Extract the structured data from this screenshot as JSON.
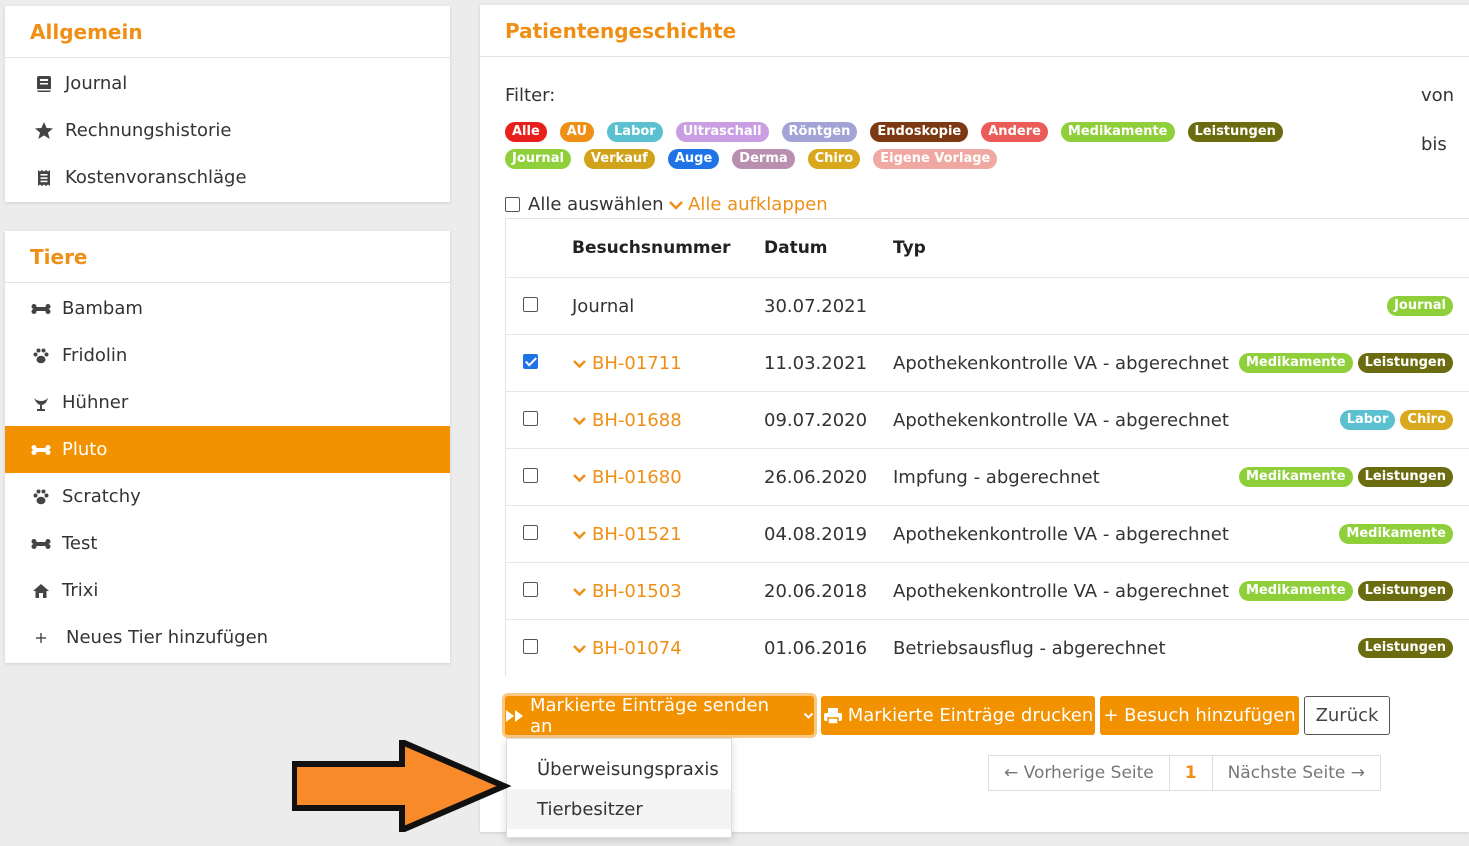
{
  "allgemein": {
    "title": "Allgemein",
    "items": [
      {
        "label": "Journal",
        "icon": "book-icon"
      },
      {
        "label": "Rechnungshistorie",
        "icon": "star-icon"
      },
      {
        "label": "Kostenvoranschläge",
        "icon": "receipt-icon"
      }
    ]
  },
  "tiere": {
    "title": "Tiere",
    "items": [
      {
        "label": "Bambam",
        "icon": "bone-icon"
      },
      {
        "label": "Fridolin",
        "icon": "paw-icon"
      },
      {
        "label": "Hühner",
        "icon": "bird-icon"
      },
      {
        "label": "Pluto",
        "icon": "bone-icon",
        "active": true
      },
      {
        "label": "Scratchy",
        "icon": "paw-icon"
      },
      {
        "label": "Test",
        "icon": "bone-icon"
      },
      {
        "label": "Trixi",
        "icon": "house-icon"
      },
      {
        "label": "Neues Tier hinzufügen",
        "icon": "plus-icon"
      }
    ]
  },
  "main": {
    "title": "Patientengeschichte",
    "filter_label": "Filter:",
    "von_label": "von",
    "bis_label": "bis",
    "filters_row1": [
      {
        "label": "Alle",
        "color": "#e8201c"
      },
      {
        "label": "AU",
        "color": "#ef8f16"
      },
      {
        "label": "Labor",
        "color": "#5bc0cf"
      },
      {
        "label": "Ultraschall",
        "color": "#c99ee3"
      },
      {
        "label": "Röntgen",
        "color": "#a3a3d6"
      },
      {
        "label": "Endoskopie",
        "color": "#7d3a12"
      },
      {
        "label": "Andere",
        "color": "#eb5b57"
      },
      {
        "label": "Medikamente",
        "color": "#8fcf3a"
      },
      {
        "label": "Leistungen",
        "color": "#6b6b10"
      }
    ],
    "filters_row2": [
      {
        "label": "Journal",
        "color": "#8fcf3a"
      },
      {
        "label": "Verkauf",
        "color": "#d1a31a"
      },
      {
        "label": "Auge",
        "color": "#1e74e7"
      },
      {
        "label": "Derma",
        "color": "#b98fb0"
      },
      {
        "label": "Chiro",
        "color": "#d9a81c"
      },
      {
        "label": "Eigene Vorlage",
        "color": "#f0a9a2"
      }
    ],
    "select_all": "Alle auswählen",
    "expand_all": "Alle aufklappen",
    "headers": {
      "num": "Besuchsnummer",
      "date": "Datum",
      "type": "Typ"
    },
    "rows": [
      {
        "num": "Journal",
        "link": false,
        "date": "30.07.2021",
        "type": "",
        "checked": false,
        "tags": [
          {
            "label": "Journal",
            "color": "#8fcf3a"
          }
        ]
      },
      {
        "num": "BH-01711",
        "link": true,
        "date": "11.03.2021",
        "type": "Apothekenkontrolle VA - abgerechnet",
        "checked": true,
        "tags": [
          {
            "label": "Medikamente",
            "color": "#8fcf3a"
          },
          {
            "label": "Leistungen",
            "color": "#6b6b10"
          }
        ]
      },
      {
        "num": "BH-01688",
        "link": true,
        "date": "09.07.2020",
        "type": "Apothekenkontrolle VA - abgerechnet",
        "checked": false,
        "tags": [
          {
            "label": "Labor",
            "color": "#5bc0cf"
          },
          {
            "label": "Chiro",
            "color": "#d9a81c"
          }
        ]
      },
      {
        "num": "BH-01680",
        "link": true,
        "date": "26.06.2020",
        "type": "Impfung - abgerechnet",
        "checked": false,
        "tags": [
          {
            "label": "Medikamente",
            "color": "#8fcf3a"
          },
          {
            "label": "Leistungen",
            "color": "#6b6b10"
          }
        ]
      },
      {
        "num": "BH-01521",
        "link": true,
        "date": "04.08.2019",
        "type": "Apothekenkontrolle VA - abgerechnet",
        "checked": false,
        "tags": [
          {
            "label": "Medikamente",
            "color": "#8fcf3a"
          }
        ]
      },
      {
        "num": "BH-01503",
        "link": true,
        "date": "20.06.2018",
        "type": "Apothekenkontrolle VA - abgerechnet",
        "checked": false,
        "tags": [
          {
            "label": "Medikamente",
            "color": "#8fcf3a"
          },
          {
            "label": "Leistungen",
            "color": "#6b6b10"
          }
        ]
      },
      {
        "num": "BH-01074",
        "link": true,
        "date": "01.06.2016",
        "type": "Betriebsausflug - abgerechnet",
        "checked": false,
        "tags": [
          {
            "label": "Leistungen",
            "color": "#6b6b10"
          }
        ]
      }
    ],
    "buttons": {
      "send": "Markierte Einträge senden an",
      "print": "Markierte Einträge drucken",
      "add": "+ Besuch hinzufügen",
      "back": "Zurück"
    },
    "dropdown": [
      "Überweisungspraxis",
      "Tierbesitzer"
    ],
    "pager": {
      "prev": "← Vorherige Seite",
      "current": "1",
      "next": "Nächste Seite →"
    }
  }
}
